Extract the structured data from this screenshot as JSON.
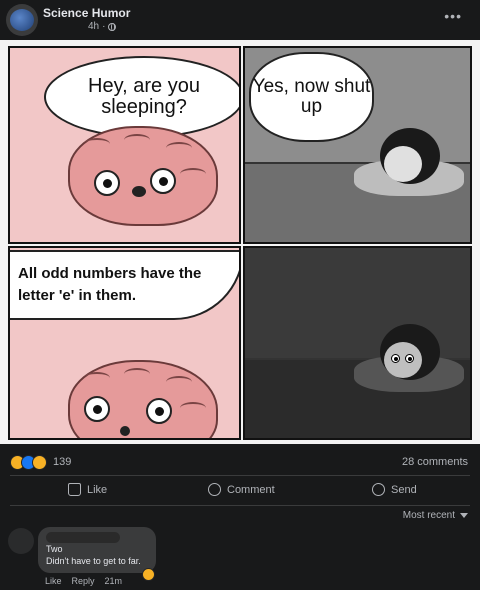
{
  "post": {
    "page_name": "Science Humor",
    "time": "4h",
    "more_icon": "more-horizontal-icon"
  },
  "meme": {
    "panel1_text": "Hey, are you sleeping?",
    "panel2_text": "Yes, now shut up",
    "panel3_text": "All odd numbers have the letter 'e' in them."
  },
  "stats": {
    "reaction_count": "139",
    "comments": "28 comments",
    "reaction_icons": [
      "haha-icon",
      "like-icon",
      "wow-icon"
    ]
  },
  "actions": {
    "like": "Like",
    "comment": "Comment",
    "send": "Send"
  },
  "comments_sort": "Most recent",
  "comment": {
    "line1": "Two",
    "line2": "Didn't have to get to far.",
    "like": "Like",
    "reply": "Reply",
    "time": "21m"
  },
  "colors": {
    "background": "#18191a",
    "text_primary": "#e4e6eb",
    "text_secondary": "#b0b3b8",
    "panel_pink": "#f2c7c7",
    "bubble": "#3a3b3c"
  }
}
